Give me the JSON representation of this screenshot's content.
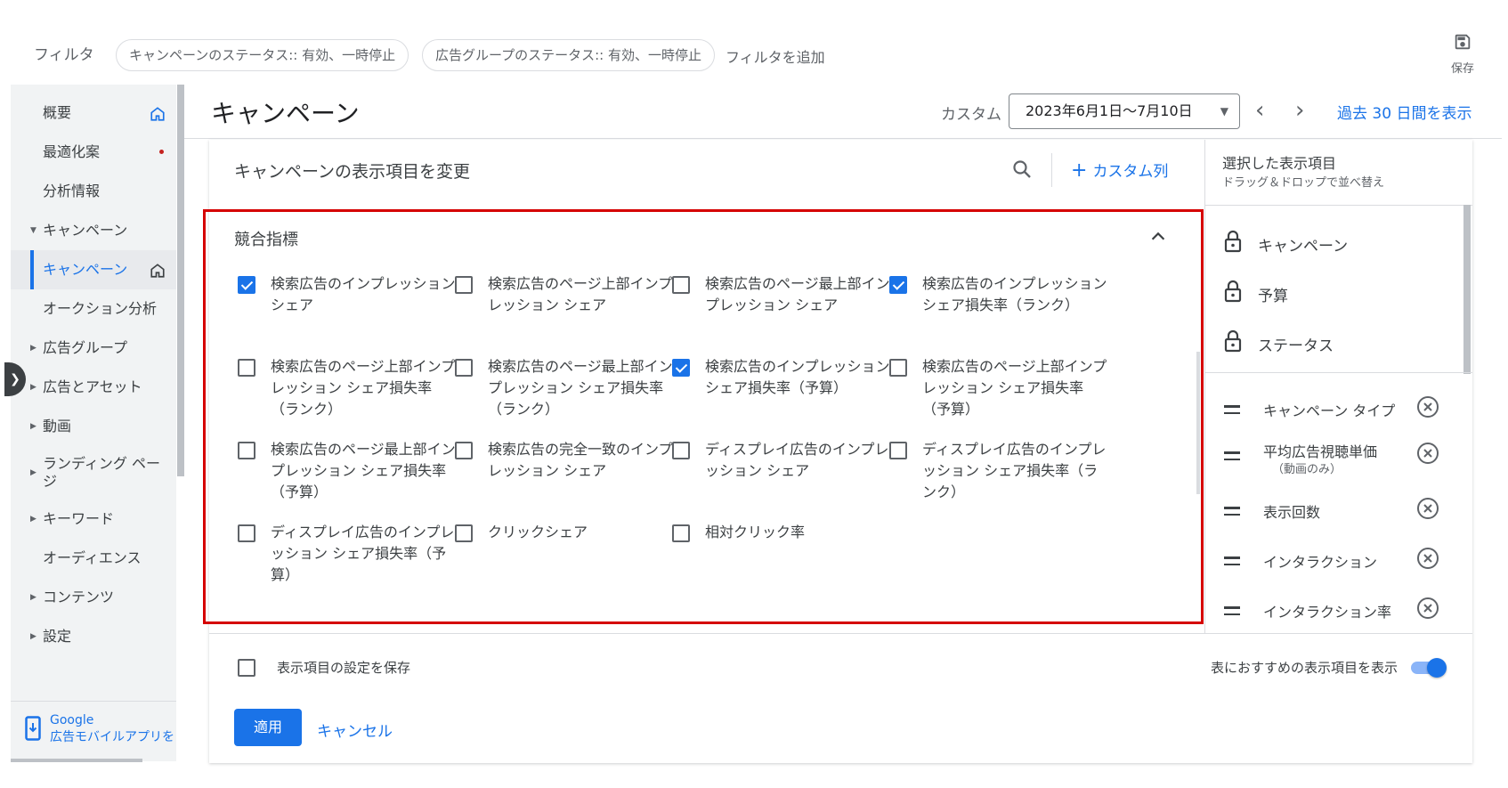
{
  "filter_bar": {
    "label": "フィルタ",
    "chips": [
      "キャンペーンのステータス:: 有効、一時停止",
      "広告グループのステータス:: 有効、一時停止"
    ],
    "add_filter": "フィルタを追加",
    "save_label": "保存"
  },
  "sidebar": {
    "items": [
      {
        "label": "概要",
        "arrow": ""
      },
      {
        "label": "最適化案",
        "arrow": ""
      },
      {
        "label": "分析情報",
        "arrow": ""
      },
      {
        "label": "キャンペーン",
        "arrow": "▼"
      },
      {
        "label": "キャンペーン",
        "arrow": ""
      },
      {
        "label": "オークション分析",
        "arrow": ""
      },
      {
        "label": "広告グループ",
        "arrow": "▶"
      },
      {
        "label": "広告とアセット",
        "arrow": "▶"
      },
      {
        "label": "動画",
        "arrow": "▶"
      },
      {
        "label": "ランディング ページ",
        "arrow": "▶"
      },
      {
        "label": "キーワード",
        "arrow": "▶"
      },
      {
        "label": "オーディエンス",
        "arrow": ""
      },
      {
        "label": "コンテンツ",
        "arrow": "▶"
      },
      {
        "label": "設定",
        "arrow": "▶"
      }
    ],
    "mobile_app": {
      "line1": "Google",
      "line2": "広告モバイルアプリを"
    }
  },
  "header": {
    "title": "キャンペーン",
    "range_label": "カスタム",
    "date_range": "2023年6月1日〜7月10日",
    "last_30": "過去 30 日間を表示"
  },
  "panel": {
    "title": "キャンペーンの表示項目を変更",
    "custom_column": "カスタム列",
    "section_title": "競合指標",
    "options": [
      {
        "label": "検索広告のインプレッション シェア",
        "checked": true
      },
      {
        "label": "検索広告のページ上部インプレッション シェア",
        "checked": false
      },
      {
        "label": "検索広告のページ最上部インプレッション シェア",
        "checked": false
      },
      {
        "label": "検索広告のインプレッション シェア損失率（ランク）",
        "checked": true
      },
      {
        "label": "検索広告のページ上部インプレッション シェア損失率（ランク）",
        "checked": false
      },
      {
        "label": "検索広告のページ最上部インプレッション シェア損失率（ランク）",
        "checked": false
      },
      {
        "label": "検索広告のインプレッション シェア損失率（予算）",
        "checked": true
      },
      {
        "label": "検索広告のページ上部インプレッション シェア損失率（予算）",
        "checked": false
      },
      {
        "label": "検索広告のページ最上部インプレッション シェア損失率（予算）",
        "checked": false
      },
      {
        "label": "検索広告の完全一致のインプレッション シェア",
        "checked": false
      },
      {
        "label": "ディスプレイ広告のインプレッション シェア",
        "checked": false
      },
      {
        "label": "ディスプレイ広告のインプレッション シェア損失率（ランク）",
        "checked": false
      },
      {
        "label": "ディスプレイ広告のインプレッション シェア損失率（予算）",
        "checked": false
      },
      {
        "label": "クリックシェア",
        "checked": false
      },
      {
        "label": "相対クリック率",
        "checked": false
      }
    ]
  },
  "selected_columns": {
    "title": "選択した表示項目",
    "subtitle": "ドラッグ＆ドロップで並べ替え",
    "locked": [
      "キャンペーン",
      "予算",
      "ステータス"
    ],
    "items": [
      {
        "label": "キャンペーン タイプ",
        "sub": ""
      },
      {
        "label": "平均広告視聴単価",
        "sub": "（動画のみ）"
      },
      {
        "label": "表示回数",
        "sub": ""
      },
      {
        "label": "インタラクション",
        "sub": ""
      },
      {
        "label": "インタラクション率",
        "sub": ""
      }
    ]
  },
  "footer": {
    "save_settings": "表示項目の設定を保存",
    "recommend": "表におすすめの表示項目を表示",
    "recommend_on": true,
    "apply": "適用",
    "cancel": "キャンセル"
  },
  "colors": {
    "accent": "#1a73e8",
    "highlight": "#d50000"
  }
}
